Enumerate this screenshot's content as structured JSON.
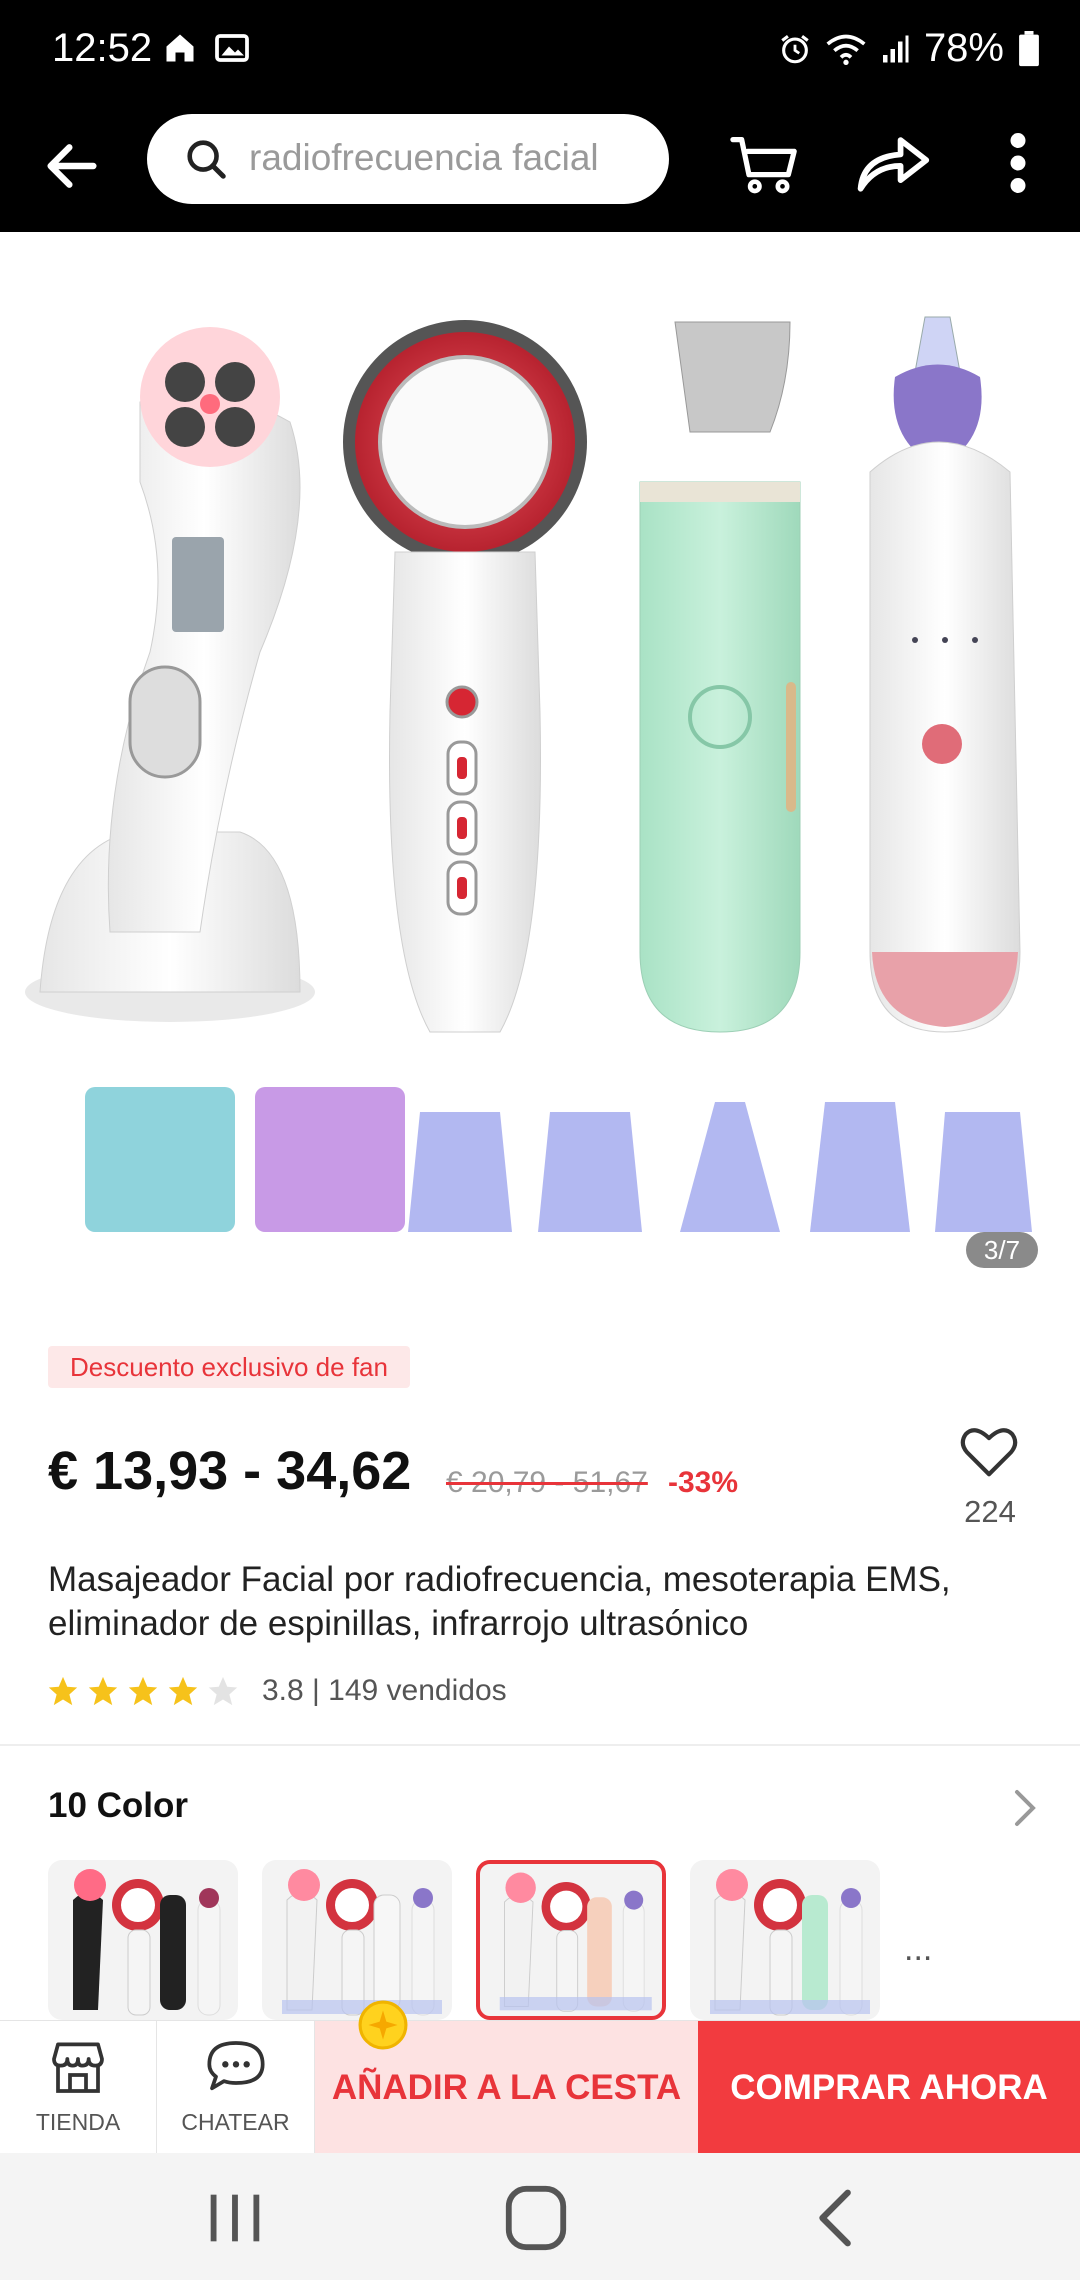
{
  "status_bar": {
    "time": "12:52",
    "battery": "78%",
    "icons": [
      "home-icon",
      "image-icon",
      "alarm-icon",
      "wifi-icon",
      "signal-icon",
      "battery-icon"
    ]
  },
  "top_bar": {
    "search_text": "radiofrecuencia facial",
    "icons": [
      "back-arrow-icon",
      "search-icon",
      "cart-icon",
      "share-icon",
      "more-vert-icon"
    ]
  },
  "gallery": {
    "page_indicator": "3/7",
    "current": 3,
    "total": 7
  },
  "product": {
    "badge": "Descuento exclusivo de fan",
    "price": "€ 13,93 - 34,62",
    "old_price": "€ 20,79 - 51,67",
    "discount": "-33%",
    "wishlist_count": "224",
    "title": "Masajeador Facial por radiofrecuencia, mesoterapia EMS, eliminador de espinillas, infrarrojo ultrasónico",
    "rating": 3.8,
    "rating_text": "3.8 | 149 vendidos",
    "stars": {
      "filled": 4,
      "total": 5
    }
  },
  "color_section": {
    "title": "10 Color",
    "more": "...",
    "swatches": [
      {
        "name": "black",
        "accent": "#222222",
        "selected": false
      },
      {
        "name": "white",
        "accent": "#eeeeee",
        "selected": false
      },
      {
        "name": "peach",
        "accent": "#f6d0bd",
        "selected": true
      },
      {
        "name": "green",
        "accent": "#b8ead0",
        "selected": false
      }
    ]
  },
  "action_bar": {
    "store_label": "TIENDA",
    "chat_label": "CHATEAR",
    "add_to_cart": "AÑADIR A LA CESTA",
    "buy_now": "COMPRAR AHORA"
  },
  "colors": {
    "accent_red": "#f23b3f",
    "price_red": "#e8343a",
    "cart_bg": "#fde2e2"
  }
}
